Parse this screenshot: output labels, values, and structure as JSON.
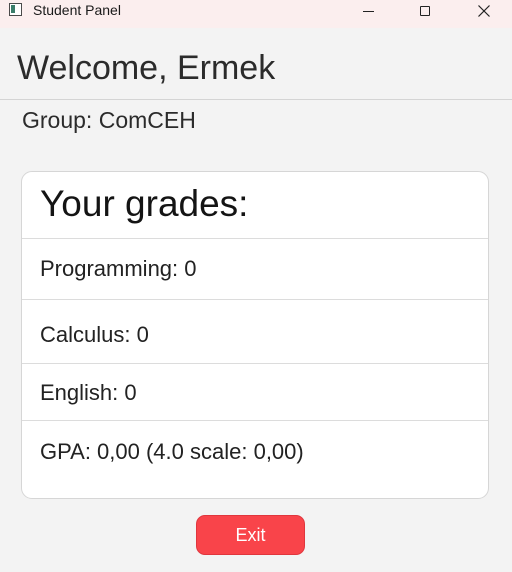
{
  "window": {
    "title": "Student Panel",
    "controls": {
      "close_glyph": "✕"
    }
  },
  "header": {
    "welcome": "Welcome, Ermek",
    "group": "Group: ComCEH"
  },
  "grades": {
    "title": "Your grades:",
    "rows": [
      "Programming: 0",
      "Calculus: 0",
      "English: 0",
      "GPA: 0,00 (4.0 scale: 0,00)"
    ]
  },
  "actions": {
    "exit_label": "Exit"
  },
  "colors": {
    "titlebar_bg": "#fbeeee",
    "window_bg": "#f3f3f3",
    "exit_button": "#f9444a"
  }
}
